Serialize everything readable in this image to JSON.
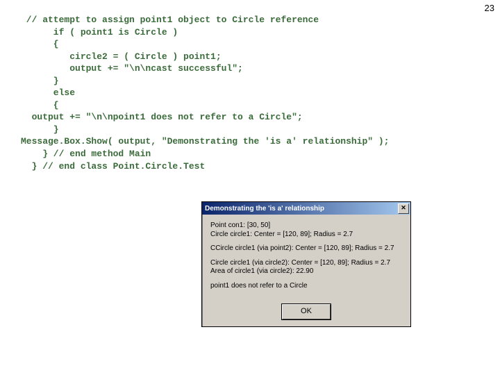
{
  "page_number": "23",
  "code_lines": {
    "l1": " // attempt to assign point1 object to Circle reference",
    "l2": "      if ( point1 is Circle )",
    "l3": "      {",
    "l4": "         circle2 = ( Circle ) point1;",
    "l5": "         output += \"\\n\\ncast successful\";",
    "l6": "      }",
    "l7": "      else",
    "l8": "      {",
    "l9": "  output += \"\\n\\npoint1 does not refer to a Circle\";",
    "l10": "      }",
    "l11": "Message.Box.Show( output, \"Demonstrating the 'is a' relationship\" );",
    "l12": "    } // end method Main",
    "l13": "  } // end class Point.Circle.Test"
  },
  "dialog": {
    "title": "Demonstrating the 'is a' relationship",
    "close_glyph": "✕",
    "body": {
      "p1": "Point con1: [30, 50]\nCircle circle1: Center = [120, 89]; Radius = 2.7",
      "p2": "CCircle circle1 (via point2): Center = [120, 89]; Radius = 2.7",
      "p3": "Circle circle1 (via circle2): Center = [120, 89]; Radius = 2.7\nArea of circle1 (via circle2): 22.90",
      "p4": "point1 does not refer to a Circle"
    },
    "ok_label": "OK"
  }
}
